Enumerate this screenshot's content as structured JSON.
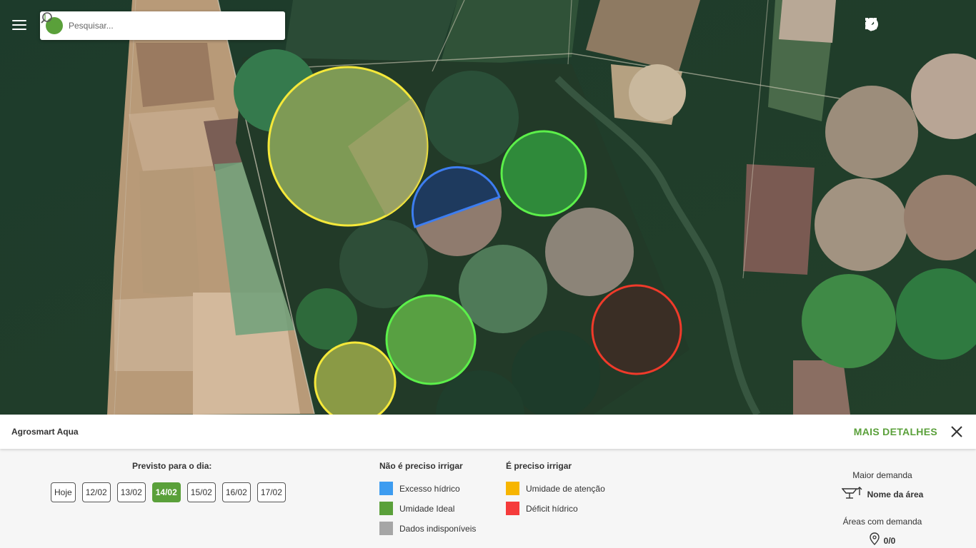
{
  "search": {
    "placeholder": "Pesquisar..."
  },
  "icons": {
    "menu": "menu-icon",
    "logo": "leaf-icon",
    "search": "search-icon",
    "top": [
      "bell-icon",
      "apps-grid-icon",
      "help-icon",
      "account-icon"
    ],
    "close": "close-icon",
    "sprinkler": "sprinkler-icon",
    "pin": "map-pin-icon"
  },
  "info_bar": {
    "title": "Agrosmart Aqua",
    "more_details": "MAIS DETALHES"
  },
  "forecast": {
    "title": "Previsto para o dia:",
    "days": [
      "Hoje",
      "12/02",
      "13/02",
      "14/02",
      "15/02",
      "16/02",
      "17/02"
    ],
    "selected": "14/02"
  },
  "legend": {
    "no_irrigation": {
      "title": "Não é preciso irrigar",
      "items": [
        {
          "label": "Excesso hídrico",
          "color": "#3d9cf0"
        },
        {
          "label": "Umidade Ideal",
          "color": "#5aa03a"
        },
        {
          "label": "Dados indisponíveis",
          "color": "#a6a6a6"
        }
      ]
    },
    "irrigation": {
      "title": "É preciso irrigar",
      "items": [
        {
          "label": "Umidade de atenção",
          "color": "#f7b500"
        },
        {
          "label": "Déficit hídrico",
          "color": "#f53b3b"
        }
      ]
    }
  },
  "demand": {
    "highest_label": "Maior demanda",
    "area_name": "Nome da área",
    "areas_label": "Áreas com demanda",
    "areas_count": "0/0"
  },
  "colors": {
    "accent": "#5aa03a",
    "status_yellow": "#f5e83a",
    "status_green": "#5cf04a",
    "status_blue": "#3d7df0",
    "status_red": "#f03a2a"
  }
}
